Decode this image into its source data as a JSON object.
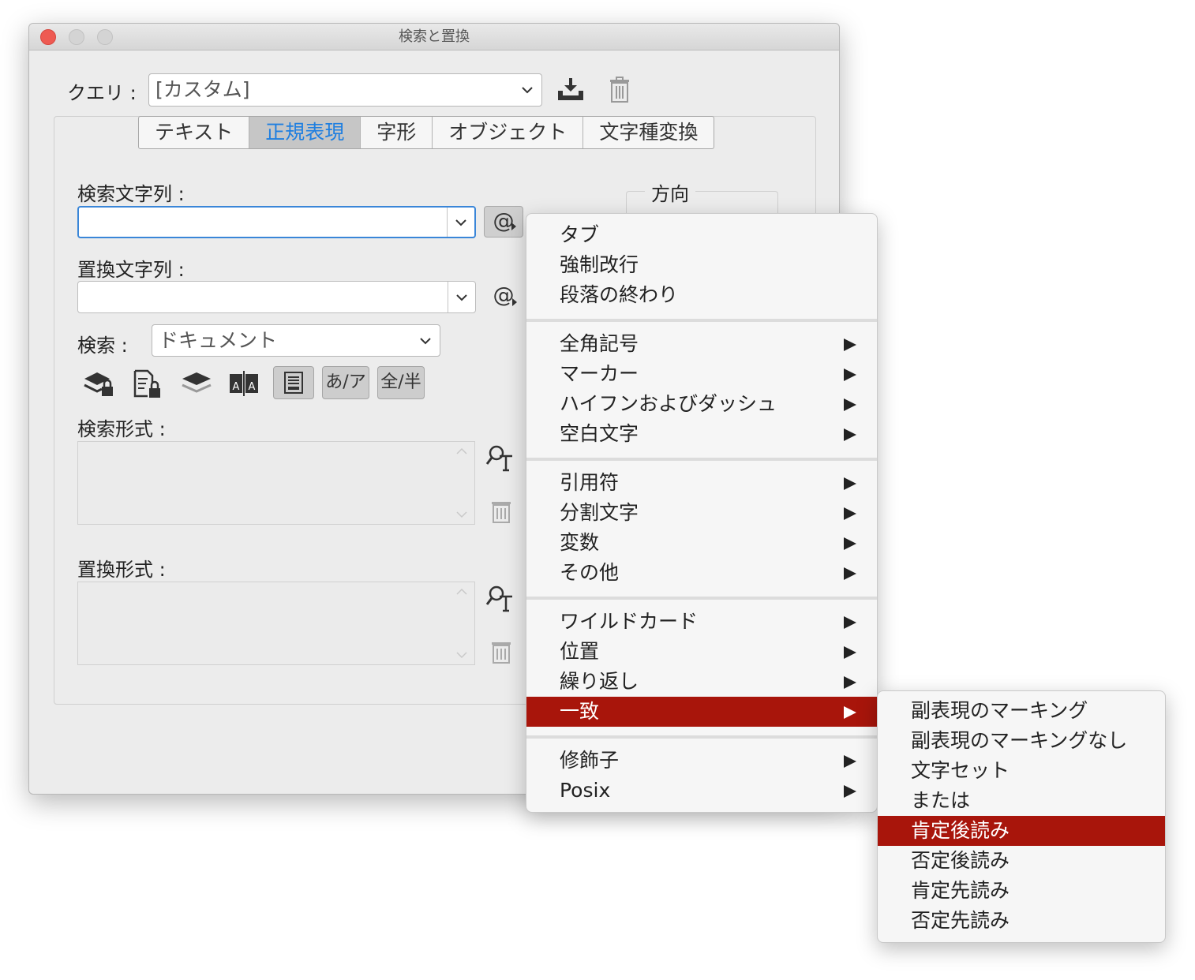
{
  "window": {
    "title": "検索と置換"
  },
  "query": {
    "label": "クエリ :",
    "value": "[カスタム]"
  },
  "tabs": [
    {
      "label": "テキスト"
    },
    {
      "label": "正規表現"
    },
    {
      "label": "字形"
    },
    {
      "label": "オブジェクト"
    },
    {
      "label": "文字種変換"
    }
  ],
  "find": {
    "label": "検索文字列 :",
    "value": "",
    "special_char_button": "@"
  },
  "change": {
    "label": "置換文字列 :",
    "value": "",
    "special_char_button": "@"
  },
  "search_scope": {
    "label": "検索 :",
    "value": "ドキュメント"
  },
  "direction": {
    "label": "方向"
  },
  "toggle_buttons": {
    "kana": "あ/ア",
    "width": "全/半"
  },
  "find_format": {
    "label": "検索形式 :"
  },
  "change_format": {
    "label": "置換形式 :"
  },
  "menu": {
    "group1": [
      "タブ",
      "強制改行",
      "段落の終わり"
    ],
    "group2": [
      "全角記号",
      "マーカー",
      "ハイフンおよびダッシュ",
      "空白文字"
    ],
    "group3": [
      "引用符",
      "分割文字",
      "変数",
      "その他"
    ],
    "group4": [
      "ワイルドカード",
      "位置",
      "繰り返し",
      "一致"
    ],
    "group5": [
      "修飾子",
      "Posix"
    ],
    "highlighted": "一致"
  },
  "submenu": {
    "items": [
      "副表現のマーキング",
      "副表現のマーキングなし",
      "文字セット",
      "または",
      "肯定後読み",
      "否定後読み",
      "肯定先読み",
      "否定先読み"
    ],
    "highlighted": "肯定後読み"
  },
  "colors": {
    "highlight": "#a8150b",
    "active_tab_text": "#1f7fe0",
    "focus_ring": "#3a86d8"
  }
}
